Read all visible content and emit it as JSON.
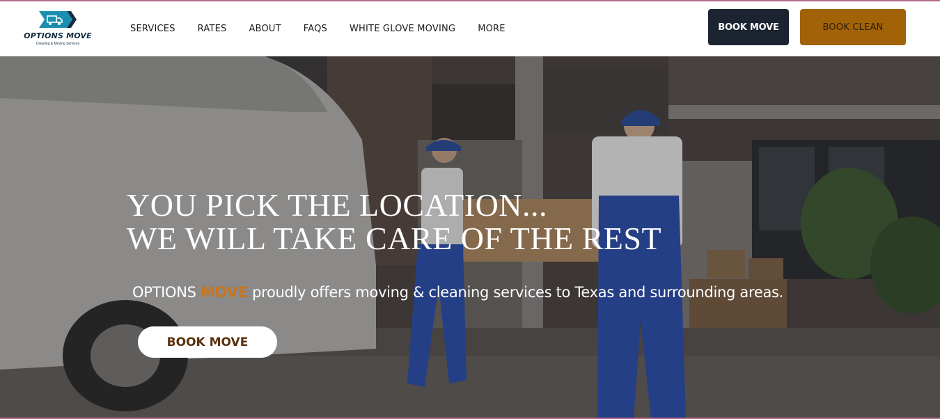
{
  "brand": {
    "name": "OPTIONS MOVE",
    "tagline": "Cleaning & Moving Services",
    "logo_icon": "moving-truck-icon",
    "colors": {
      "navy": "#152c3f",
      "teal": "#1a8fb0"
    }
  },
  "nav": {
    "items": [
      {
        "label": "SERVICES"
      },
      {
        "label": "RATES"
      },
      {
        "label": "ABOUT"
      },
      {
        "label": "FAQS"
      },
      {
        "label": "WHITE GLOVE MOVING"
      },
      {
        "label": "MORE"
      }
    ]
  },
  "header_buttons": {
    "book_move": "BOOK MOVE",
    "book_clean": "BOOK CLEAN",
    "colors": {
      "book_move_bg": "#1d2431",
      "book_clean_bg": "#a26308"
    }
  },
  "hero": {
    "headline_line1": "YOU PICK THE LOCATION...",
    "headline_line2": "WE WILL TAKE CARE OF THE REST",
    "tagline_prefix": "OPTIONS",
    "tagline_accent": "MOVE",
    "tagline_suffix": "proudly offers moving & cleaning services to Texas and surrounding areas.",
    "cta_label": "BOOK MOVE",
    "accent_color": "#c9741f"
  }
}
